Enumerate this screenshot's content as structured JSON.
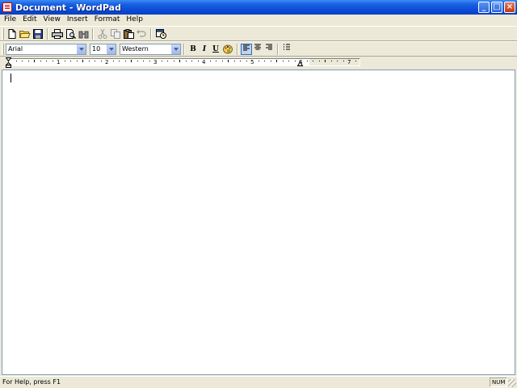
{
  "window": {
    "title": "Document - WordPad"
  },
  "menu": [
    "File",
    "Edit",
    "View",
    "Insert",
    "Format",
    "Help"
  ],
  "format_bar": {
    "font_name": "Arial",
    "font_size": "10",
    "script": "Western",
    "bold_label": "B",
    "italic_label": "I",
    "underline_label": "U"
  },
  "ruler": {
    "numbers": [
      "1",
      "2",
      "3",
      "4",
      "5",
      "6",
      "7"
    ]
  },
  "status": {
    "help_text": "For Help, press F1",
    "num_indicator": "NUM"
  },
  "colors": {
    "titlebar": "#0a4bd8",
    "chrome": "#ece9d8",
    "document": "#ffffff"
  }
}
